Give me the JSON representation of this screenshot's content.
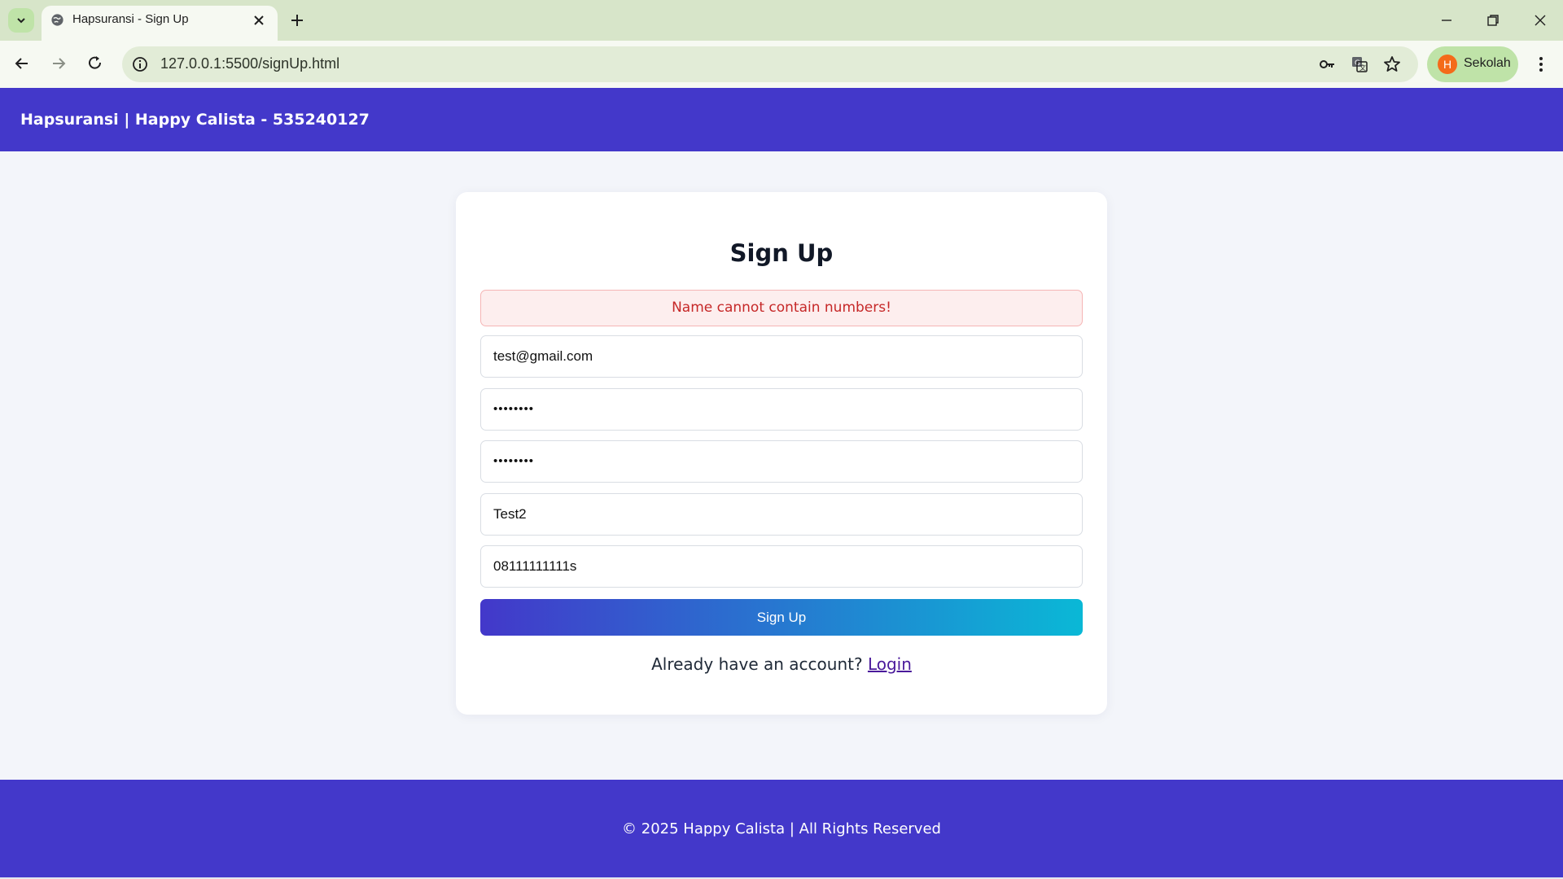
{
  "browser": {
    "tab_title": "Hapsuransi - Sign Up",
    "url": "127.0.0.1:5500/signUp.html",
    "profile_initial": "H",
    "profile_name": "Sekolah",
    "colors": {
      "tabstrip": "#d7e5c9",
      "toolbar": "#f6f9f2",
      "omnibox": "#e2ecd7",
      "profile_chip": "#bfe3a8",
      "avatar": "#f46b1a"
    }
  },
  "header": {
    "brand": "Hapsuransi | Happy Calista - 535240127",
    "bg_color": "#4338ca"
  },
  "form": {
    "title": "Sign Up",
    "error_message": "Name cannot contain numbers!",
    "fields": [
      {
        "name": "email",
        "value": "test@gmail.com"
      },
      {
        "name": "password",
        "value": "••••••••"
      },
      {
        "name": "confirm-password",
        "value": "••••••••"
      },
      {
        "name": "full-name",
        "value": "Test2"
      },
      {
        "name": "phone",
        "value": "08111111111s"
      }
    ],
    "submit_label": "Sign Up",
    "login_prompt": "Already have an account?",
    "login_link": "Login",
    "button_gradient": [
      "#4338ca",
      "#0ab8d6"
    ]
  },
  "footer": {
    "copyright": "© 2025 Happy Calista | All Rights Reserved"
  },
  "icons": [
    "tab-list-icon",
    "globe-icon",
    "close-icon",
    "plus-icon",
    "minimize-icon",
    "restore-icon",
    "window-close-icon",
    "back-icon",
    "forward-icon",
    "reload-icon",
    "site-info-icon",
    "key-icon",
    "translate-icon",
    "star-icon",
    "more-vert-icon"
  ]
}
